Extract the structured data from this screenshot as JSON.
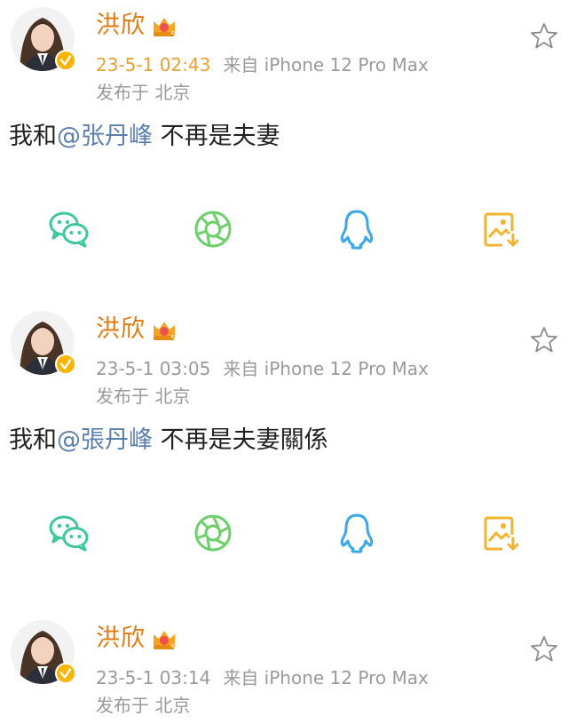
{
  "colors": {
    "username": "#e07a10",
    "time": "#e8a033",
    "meta": "#9a9a9a",
    "mention": "#5b7fad",
    "wechat": "#3dc79a",
    "moments": "#6ccf6a",
    "qq": "#3aa7e8",
    "save": "#f0b431"
  },
  "posts": [
    {
      "username": "洪欣",
      "vip_level": "5",
      "time": "23-5-1 02:43",
      "source": "来自 iPhone 12 Pro Max",
      "location": "发布于 北京",
      "content_before": "我和",
      "mention": "@张丹峰",
      "content_after": " 不再是夫妻",
      "share_icons": [
        "wechat-icon",
        "moments-icon",
        "qq-icon",
        "save-image-icon"
      ]
    },
    {
      "username": "洪欣",
      "vip_level": "5",
      "time": "23-5-1 03:05",
      "source": "来自 iPhone 12 Pro Max",
      "location": "发布于 北京",
      "content_before": "我和",
      "mention": "@張丹峰",
      "content_after": " 不再是夫妻關係",
      "share_icons": [
        "wechat-icon",
        "moments-icon",
        "qq-icon",
        "save-image-icon"
      ]
    },
    {
      "username": "洪欣",
      "vip_level": "5",
      "time": "23-5-1 03:14",
      "source": "来自 iPhone 12 Pro Max",
      "location": "发布于 北京"
    }
  ]
}
